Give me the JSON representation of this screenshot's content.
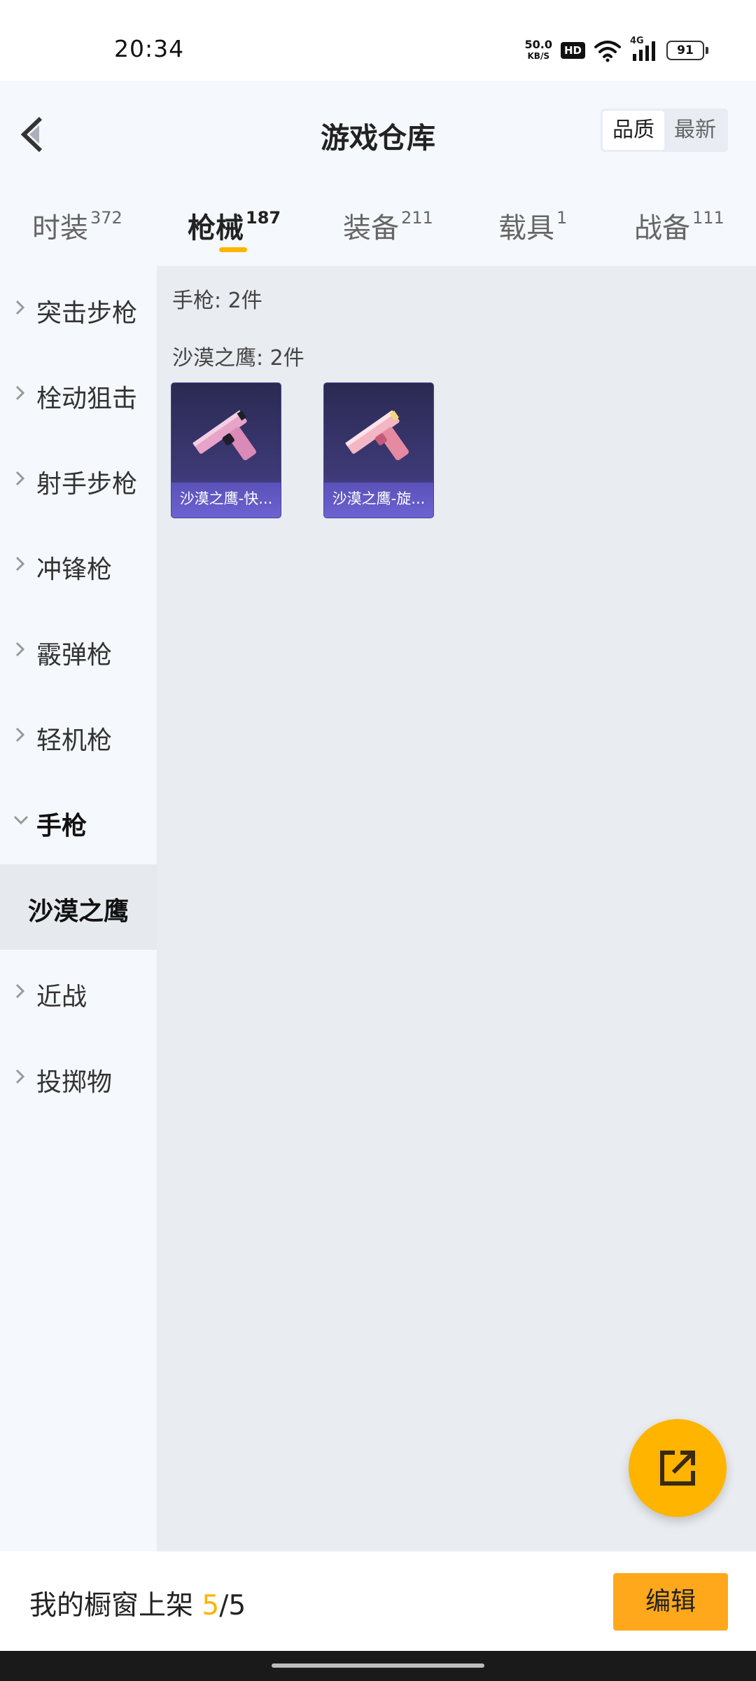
{
  "status_bar": {
    "time": "20:34",
    "net_speed_value": "50.0",
    "net_speed_unit": "KB/S",
    "hd_label": "HD",
    "network_label": "4G",
    "battery": "91"
  },
  "header": {
    "title": "游戏仓库",
    "sort_options": [
      "品质",
      "最新"
    ],
    "active_sort": "品质"
  },
  "tabs": [
    {
      "label": "时装",
      "count": "372"
    },
    {
      "label": "枪械",
      "count": "187"
    },
    {
      "label": "装备",
      "count": "211"
    },
    {
      "label": "载具",
      "count": "1"
    },
    {
      "label": "战备",
      "count": "111"
    }
  ],
  "active_tab": "枪械",
  "sidebar": {
    "items": [
      {
        "label": "突击步枪"
      },
      {
        "label": "栓动狙击"
      },
      {
        "label": "射手步枪"
      },
      {
        "label": "冲锋枪"
      },
      {
        "label": "霰弹枪"
      },
      {
        "label": "轻机枪"
      },
      {
        "label": "手枪"
      },
      {
        "label": "近战"
      },
      {
        "label": "投掷物"
      }
    ],
    "expanded_item": "手枪",
    "sub_item": "沙漠之鹰"
  },
  "content": {
    "category_title": "手枪: 2件",
    "group_title": "沙漠之鹰: 2件",
    "items": [
      {
        "name": "沙漠之鹰-快..."
      },
      {
        "name": "沙漠之鹰-旋..."
      }
    ]
  },
  "bottom_bar": {
    "shelf_label": "我的橱窗上架",
    "shelf_current": "5",
    "shelf_total": "/5",
    "edit_label": "编辑"
  },
  "colors": {
    "accent": "#ffb400",
    "card_bg": "#3e3a78",
    "card_label_bg": "#6d62d2"
  }
}
